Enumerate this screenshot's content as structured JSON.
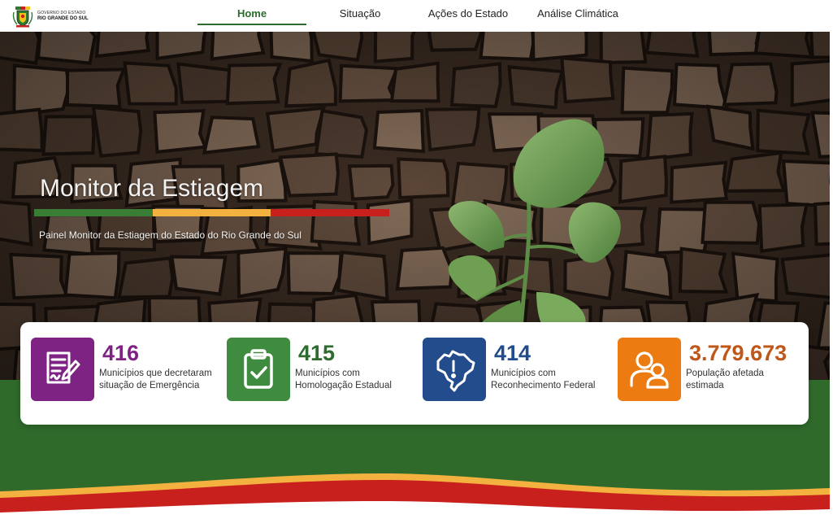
{
  "header": {
    "logo": {
      "line1": "GOVERNO DO ESTADO",
      "line2": "RIO GRANDE DO SUL"
    },
    "nav": [
      {
        "label": "Home",
        "active": true
      },
      {
        "label": "Situação",
        "active": false
      },
      {
        "label": "Ações do Estado",
        "active": false
      },
      {
        "label": "Análise Climática",
        "active": false
      }
    ]
  },
  "hero": {
    "title": "Monitor da Estiagem",
    "subtitle": "Painel Monitor da Estiagem do Estado do Rio Grande do Sul",
    "stripe_colors": [
      "#3a7d35",
      "#f3b23f",
      "#c8201d"
    ]
  },
  "stats": [
    {
      "icon": "signed-document-icon",
      "value": "416",
      "label": "Municípios que decretaram situação de Emergência",
      "color": "#7e2284"
    },
    {
      "icon": "clipboard-check-icon",
      "value": "415",
      "label": "Municípios com Homologação Estadual",
      "color": "#3f8b3f"
    },
    {
      "icon": "brazil-map-alert-icon",
      "value": "414",
      "label": "Municípios com Reconhecimento Federal",
      "color": "#234c8d"
    },
    {
      "icon": "users-icon",
      "value": "3.779.673",
      "label": "População afetada estimada",
      "color": "#ec7b12"
    }
  ],
  "colors": {
    "brand_green": "#2e6b2e",
    "footer_green": "#2f6a2b",
    "value_colors": [
      "#7e2284",
      "#2e6b2e",
      "#234c8d",
      "#c0571a"
    ]
  }
}
